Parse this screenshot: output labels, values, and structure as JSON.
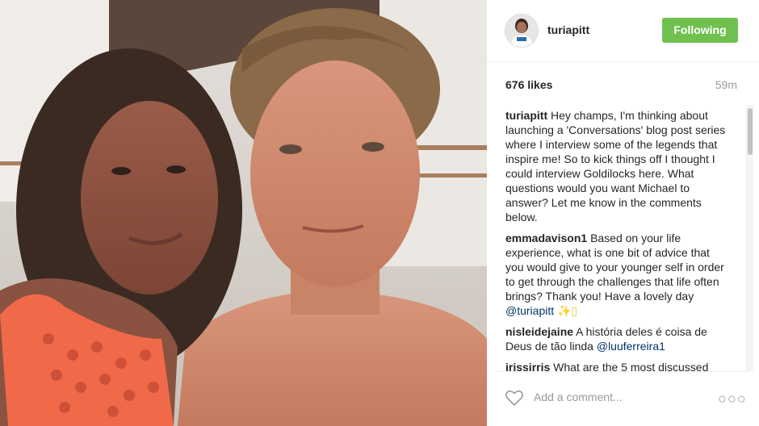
{
  "header": {
    "username": "turiapitt",
    "follow_label": "Following"
  },
  "post": {
    "likes": "676 likes",
    "time": "59m"
  },
  "comments": [
    {
      "user": "turiapitt",
      "text": "Hey champs, I'm thinking about launching a 'Conversations' blog post series where I interview some of the legends that inspire me! So to kick things off I thought I could interview Goldilocks here. What questions would you want Michael to answer? Let me know in the comments below."
    },
    {
      "user": "emmadavison1",
      "text": "Based on your life experience, what is one bit of advice that you would give to your younger self in order to get through the challenges that life often brings? Thank you! Have a lovely day",
      "mention": "@turiapitt",
      "emoji": "✨▯"
    },
    {
      "user": "nisleidejaine",
      "text": "A história deles é coisa de Deus de tão linda",
      "mention": "@luuferreira1"
    },
    {
      "user": "irissirris",
      "text": "What are the 5 most discussed"
    }
  ],
  "composer": {
    "placeholder": "Add a comment...",
    "more_glyph": "○○○"
  },
  "colors": {
    "follow_green": "#70c050",
    "mention_blue": "#003569"
  }
}
